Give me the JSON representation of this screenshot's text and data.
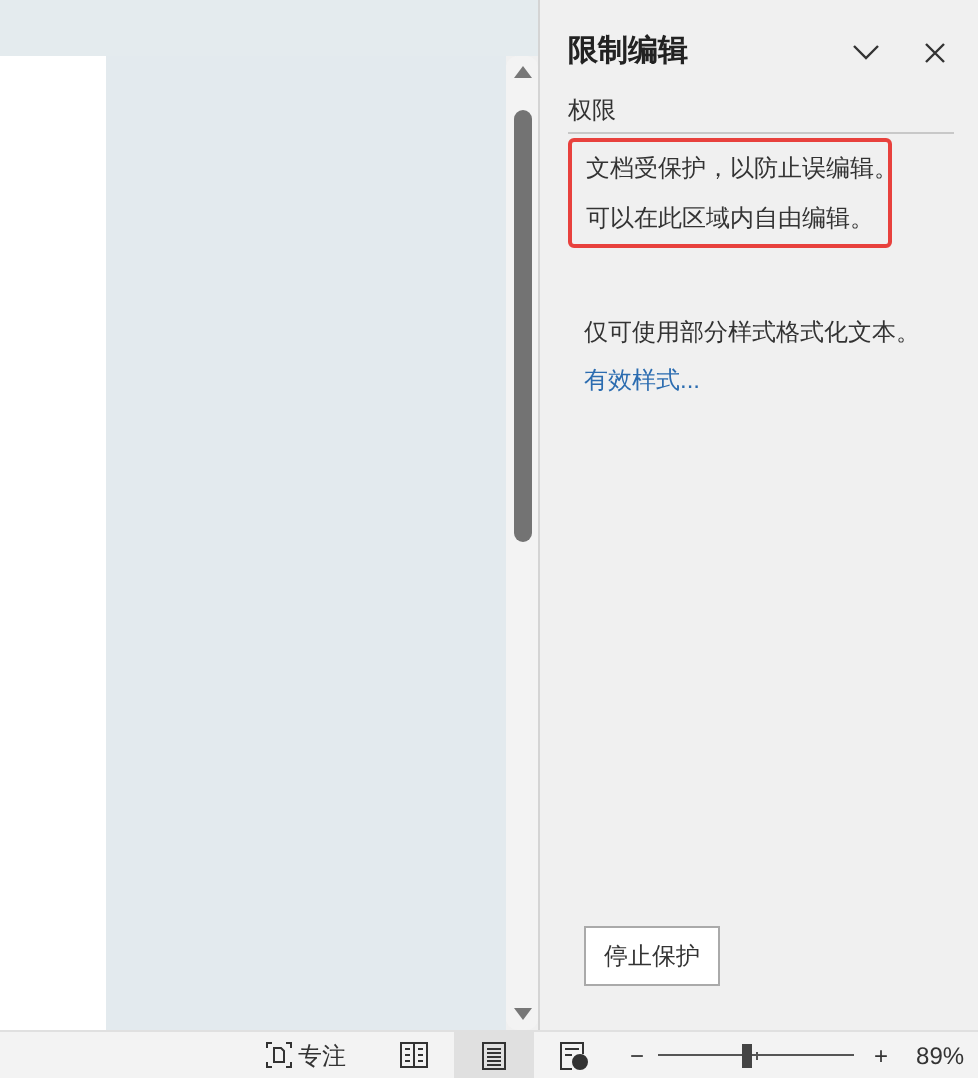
{
  "panel": {
    "title": "限制编辑",
    "section_label": "权限",
    "protection_notice": [
      "文档受保护，以防止误编辑。",
      "可以在此区域内自由编辑。"
    ],
    "formatting_note": "仅可使用部分样式格式化文本。",
    "styles_link": "有效样式...",
    "stop_button": "停止保护"
  },
  "status_bar": {
    "focus_label": "专注",
    "views": [
      {
        "kind": "read",
        "selected": false
      },
      {
        "kind": "print",
        "selected": true
      },
      {
        "kind": "web",
        "selected": false
      }
    ],
    "zoom_minus": "−",
    "zoom_plus": "+",
    "zoom": {
      "level": 0.45
    },
    "zoom_percent": "89%"
  }
}
